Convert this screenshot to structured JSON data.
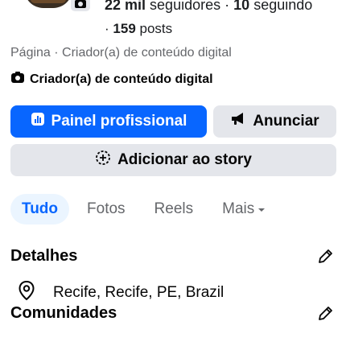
{
  "header": {
    "followers_count": "22 mil",
    "followers_label": "seguidores",
    "separator": "·",
    "following_count": "10",
    "following_label": "seguindo",
    "posts_prefix": "·",
    "posts_count": "159",
    "posts_label": "posts"
  },
  "profile": {
    "category_line": "Página · Criador(a) de conteúdo digital",
    "creator_badge": "Criador(a) de conteúdo digital"
  },
  "actions": {
    "primary_label": "Painel profissional",
    "advertise_label": "Anunciar",
    "story_label": "Adicionar ao story"
  },
  "tabs": [
    {
      "label": "Tudo",
      "active": true
    },
    {
      "label": "Fotos",
      "active": false
    },
    {
      "label": "Reels",
      "active": false
    },
    {
      "label": "Mais",
      "active": false
    }
  ],
  "details": {
    "title": "Detalhes",
    "location": "Recife, Recife, PE, Brazil"
  },
  "communities": {
    "title": "Comunidades"
  },
  "colors": {
    "accent": "#0866ff",
    "secondary_bg": "#e4e6eb",
    "muted_text": "#65676b",
    "active_tab_bg": "#ebf5ff"
  },
  "icons": {
    "camera": "camera-icon",
    "creator": "creator-icon",
    "dashboard": "dashboard-icon",
    "megaphone": "megaphone-icon",
    "story_add": "add-story-icon",
    "dropdown": "caret-down-icon",
    "edit": "pencil-icon",
    "location": "location-pin-icon"
  }
}
